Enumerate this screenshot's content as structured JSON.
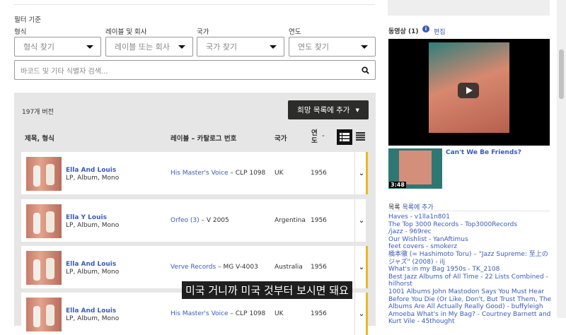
{
  "filters": {
    "heading": "필터 기준",
    "format_label": "형식",
    "label_label": "레이블 및 회사",
    "country_label": "국가",
    "year_label": "연도",
    "format_placeholder": "형식 찾기",
    "label_placeholder": "레이블 또는 회사",
    "country_placeholder": "국가 찾기",
    "year_placeholder": "연도 찾기",
    "search_placeholder": "바코드 및 기타 식별자 검색..."
  },
  "versions": {
    "count": "197개 버전",
    "add_button": "희망 목록에 추가",
    "columns": {
      "title": "제목, 형식",
      "label": "레이블 – 카탈로그 번호",
      "country": "국가",
      "year": "연도"
    },
    "rows": [
      {
        "title": "Ella And Louis",
        "format": "LP, Album, Mono",
        "label": "His Master's Voice",
        "catno": " – CLP 1098",
        "country": "UK",
        "year": "1956"
      },
      {
        "title": "Ella Y Louis",
        "format": "LP, Album, Mono",
        "label": "Orfeo (3)",
        "catno": " – V 2005",
        "country": "Argentina",
        "year": "1956"
      },
      {
        "title": "Ella And Louis",
        "format": "LP, Album, Mono",
        "label": "Verve Records",
        "catno": " – MG V-4003",
        "country": "Australia",
        "year": "1956"
      },
      {
        "title": "Ella And Louis",
        "format": "LP, Album, Mono",
        "label": "His Master's Voice",
        "catno": " – CLP 1098",
        "country": "UK",
        "year": "1956"
      }
    ]
  },
  "videos": {
    "heading": "동영상 (1)",
    "edit": "편집",
    "item_title": "Can't We Be Friends?",
    "duration": "3:48"
  },
  "lists": {
    "heading": "목록",
    "add": "목록에 추가",
    "items": [
      "Haves - v1lla1n801",
      "The Top 3000 Records - Top3000Records",
      "/jazz - 969rec",
      "Our Wishlist - YanAftimus",
      "feet covers - smokerz",
      "橋本徹 (= Hashimoto Toru) – \"Jazz Supreme: 至上のジャズ\" (2008) - ilj",
      "What's in my Bag 1950s - TK_2108",
      "Best Jazz Albums of All Time - 22 Lists Combined - hilhorst",
      "1001 Albums John Mastodon Says You Must Hear Before You Die (Or Like, Don't, But Trust Them, The Albums Are All Actually Really Good) - buffyleigh",
      "Amoeba What's in My Bag? - Courtney Barnett and Kurt Vile - 45thought"
    ]
  },
  "caption": "미국 거니까 미국 것부터 보시면 돼요"
}
